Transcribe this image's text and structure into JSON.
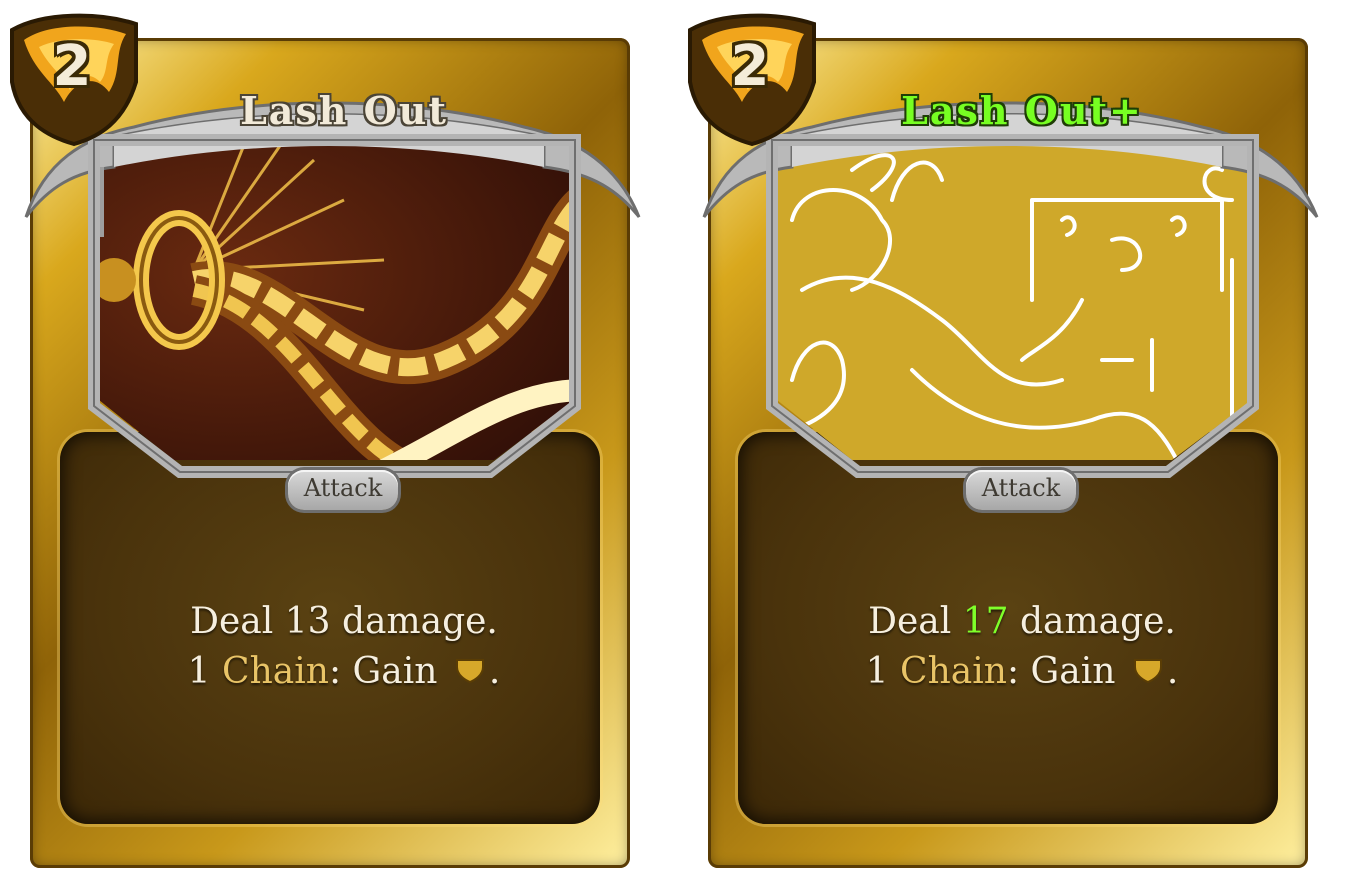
{
  "cards": [
    {
      "cost": "2",
      "name": "Lash Out",
      "type": "Attack",
      "line1_pre": "Deal ",
      "damage": "13",
      "line1_post": " damage.",
      "line2_count": "1 ",
      "keyword": "Chain",
      "line2_mid": ": Gain ",
      "line2_end": ".",
      "icon": "gold-shield-icon"
    },
    {
      "cost": "2",
      "name": "Lash Out+",
      "type": "Attack",
      "line1_pre": "Deal ",
      "damage": "17",
      "line1_post": " damage.",
      "line2_count": "1 ",
      "keyword": "Chain",
      "line2_mid": ": Gain ",
      "line2_end": ".",
      "icon": "gold-shield-icon"
    }
  ],
  "colors": {
    "frame_gold": "#c8981a",
    "panel_brown": "#4a330c",
    "keyword_gold": "#e9c467",
    "upgrade_green": "#77ff22",
    "sketch_bg": "#cfa82a"
  }
}
